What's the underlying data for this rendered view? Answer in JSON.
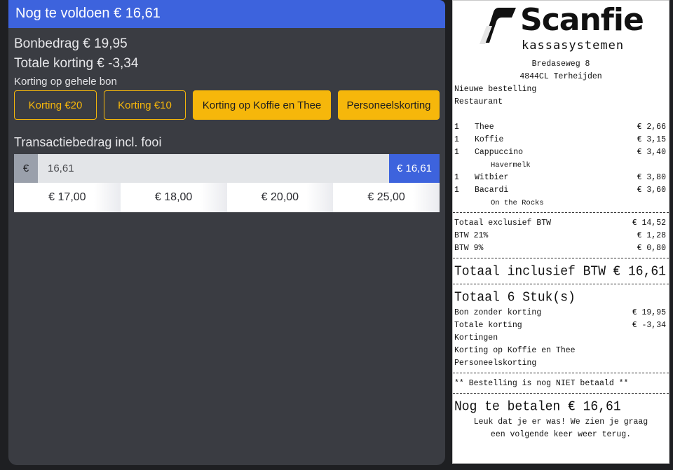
{
  "header": {
    "title": "Nog te voldoen € 16,61"
  },
  "summary": {
    "bonbedrag": "Bonbedrag € 19,95",
    "korting": "Totale korting € -3,34",
    "korting_label": "Korting op gehele bon"
  },
  "discounts": [
    {
      "label": "Korting €20"
    },
    {
      "label": "Korting €10"
    },
    {
      "label": "Korting op Koffie en Thee"
    },
    {
      "label": "Personeelskorting"
    }
  ],
  "transaction": {
    "label": "Transactiebedrag incl. fooi",
    "currency": "€",
    "value": "16,61",
    "button": "€ 16,61",
    "presets": [
      "€ 17,00",
      "€ 18,00",
      "€ 20,00",
      "€ 25,00"
    ]
  },
  "receipt": {
    "logo_word": "Scanfie",
    "logo_sub": "kassasystemen",
    "address1": "Bredaseweg 8",
    "address2": "4844CL Terheijden",
    "order_type": "Nieuwe bestelling",
    "location": "Restaurant",
    "items": [
      {
        "qty": "1",
        "name": "Thee",
        "price": "€ 2,66"
      },
      {
        "qty": "1",
        "name": "Koffie",
        "price": "€ 3,15"
      },
      {
        "qty": "1",
        "name": "Cappuccino",
        "price": "€ 3,40",
        "mod": "Havermelk"
      },
      {
        "qty": "1",
        "name": "Witbier",
        "price": "€ 3,80"
      },
      {
        "qty": "1",
        "name": "Bacardi",
        "price": "€ 3,60",
        "mod": "On the Rocks"
      }
    ],
    "excl_label": "Totaal exclusief BTW",
    "excl_value": "€ 14,52",
    "btw21_label": "BTW 21%",
    "btw21_value": "€ 1,28",
    "btw9_label": "BTW 9%",
    "btw9_value": "€ 0,80",
    "incl_label": "Totaal inclusief BTW",
    "incl_value": "€ 16,61",
    "count_label": "Totaal 6 Stuk(s)",
    "zonder_label": "Bon zonder korting",
    "zonder_value": "€ 19,95",
    "korting_label": "Totale korting",
    "korting_value": "€ -3,34",
    "kortingen_label": "Kortingen",
    "korting1": "Korting op Koffie en Thee",
    "korting2": "Personeelskorting",
    "status": "** Bestelling is nog NIET betaald **",
    "to_pay": "Nog te betalen € 16,61",
    "footer1": "Leuk dat je er was! We zien je graag",
    "footer2": "een volgende keer weer terug."
  }
}
